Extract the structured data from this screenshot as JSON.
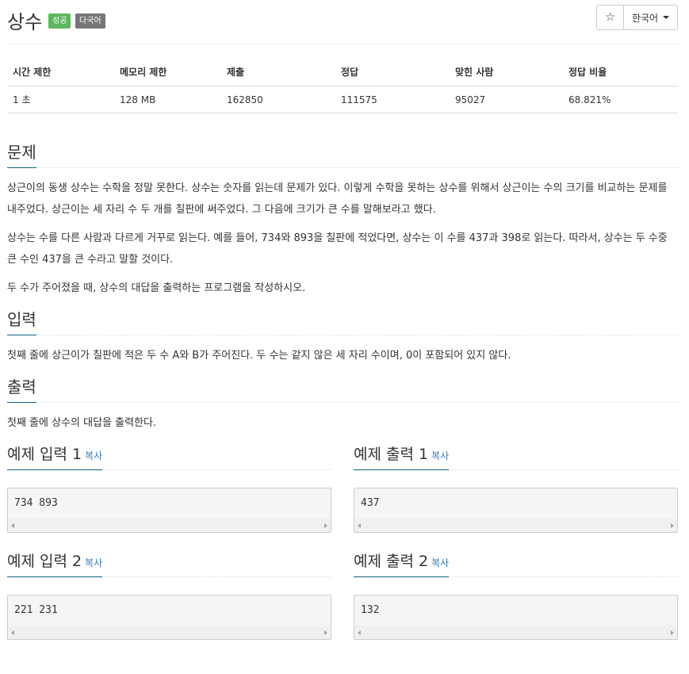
{
  "header": {
    "title": "상수",
    "badges": [
      "성공",
      "다국어"
    ],
    "star_icon": "star-icon",
    "star_glyph": "☆",
    "language": "한국어"
  },
  "info_table": {
    "headers": [
      "시간 제한",
      "메모리 제한",
      "제출",
      "정답",
      "맞힌 사람",
      "정답 비율"
    ],
    "values": [
      "1 초",
      "128 MB",
      "162850",
      "111575",
      "95027",
      "68.821%"
    ]
  },
  "problem": {
    "title": "문제",
    "paragraphs": [
      "상근이의 동생 상수는 수학을 정말 못한다. 상수는 숫자를 읽는데 문제가 있다. 이렇게 수학을 못하는 상수를 위해서 상근이는 수의 크기를 비교하는 문제를 내주었다. 상근이는 세 자리 수 두 개를 칠판에 써주었다. 그 다음에 크기가 큰 수를 말해보라고 했다.",
      "상수는 수를 다른 사람과 다르게 거꾸로 읽는다. 예를 들어, 734와 893을 칠판에 적었다면, 상수는 이 수를 437과 398로 읽는다. 따라서, 상수는 두 수중 큰 수인 437을 큰 수라고 말할 것이다.",
      "두 수가 주어졌을 때, 상수의 대답을 출력하는 프로그램을 작성하시오."
    ]
  },
  "input": {
    "title": "입력",
    "text": "첫째 줄에 상근이가 칠판에 적은 두 수 A와 B가 주어진다. 두 수는 같지 않은 세 자리 수이며, 0이 포함되어 있지 않다."
  },
  "output": {
    "title": "출력",
    "text": "첫째 줄에 상수의 대답을 출력한다."
  },
  "samples": {
    "copy_label": "복사",
    "input1": {
      "title": "예제 입력 1",
      "content": "734 893"
    },
    "output1": {
      "title": "예제 출력 1",
      "content": "437"
    },
    "input2": {
      "title": "예제 입력 2",
      "content": "221 231"
    },
    "output2": {
      "title": "예제 출력 2",
      "content": "132"
    }
  },
  "colors": {
    "success_badge": "#5cb85c",
    "multilang_badge": "#777777",
    "heading_underline": "#0e6680",
    "link": "#337ab7"
  }
}
